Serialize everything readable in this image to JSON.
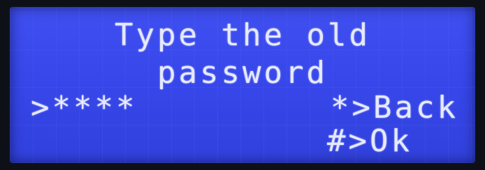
{
  "lcd": {
    "line1": "Type the old",
    "line2": "password",
    "input_prompt": ">****",
    "back_option": "*>Back",
    "ok_option": "#>Ok"
  }
}
